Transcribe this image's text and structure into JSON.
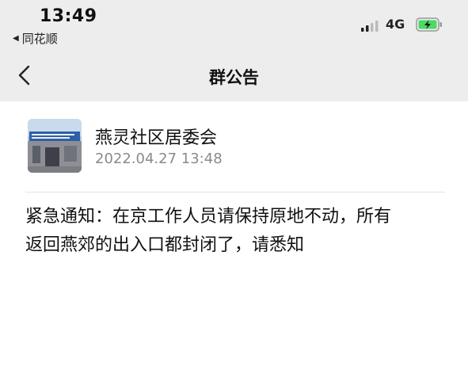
{
  "status_bar": {
    "time": "13:49",
    "back_app_label": "同花顺",
    "network": "4G"
  },
  "nav": {
    "title": "群公告"
  },
  "announcement": {
    "author": "燕灵社区居委会",
    "timestamp": "2022.04.27  13:48",
    "body_line_1": "紧急通知：在京工作人员请保持原地不动，所有",
    "body_line_2": "返回燕郊的出入口都封闭了，请悉知"
  },
  "colors": {
    "header_bg": "#ededed",
    "battery_fill": "#4cd964",
    "timestamp_gray": "#8a8a8a"
  },
  "icons": {
    "back": "chevron-left-icon",
    "back_app": "triangle-left-icon",
    "signal": "cellular-signal-icon",
    "battery": "battery-charging-icon"
  }
}
